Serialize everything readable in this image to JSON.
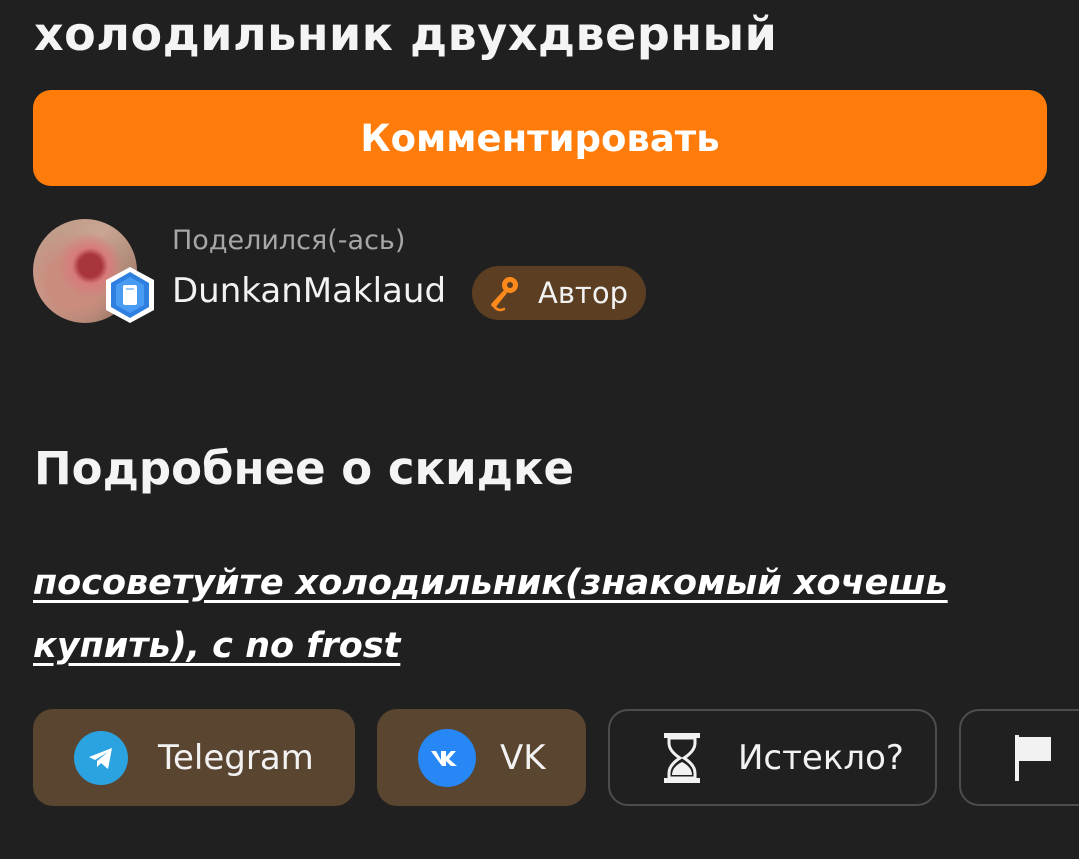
{
  "deal": {
    "title": "холодильник двухдверный"
  },
  "actions": {
    "comment_label": "Комментировать"
  },
  "author": {
    "shared_label": "Поделился(-ась)",
    "name": "DunkanMaklaud",
    "tag_label": "Автор"
  },
  "details": {
    "section_title": "Подробнее о скидке",
    "link_text": "посоветуйте холодильник(знакомый хочешь купить), с no frost"
  },
  "share": {
    "telegram_label": "Telegram",
    "vk_label": "VK",
    "expired_label": "Истекло?"
  },
  "icons": {
    "telegram": "telegram-icon",
    "vk": "vk-icon",
    "expired": "hourglass-icon",
    "report": "flag-icon",
    "author_tag": "microphone-icon",
    "level": "hexagon-badge-icon"
  },
  "colors": {
    "background": "#202020",
    "accent": "#ff7b0a",
    "share_button": "#5a4530",
    "author_tag": "#5c3f22",
    "telegram": "#2aa3e0",
    "vk": "#2787f5",
    "badge": "#2f7fe0"
  }
}
